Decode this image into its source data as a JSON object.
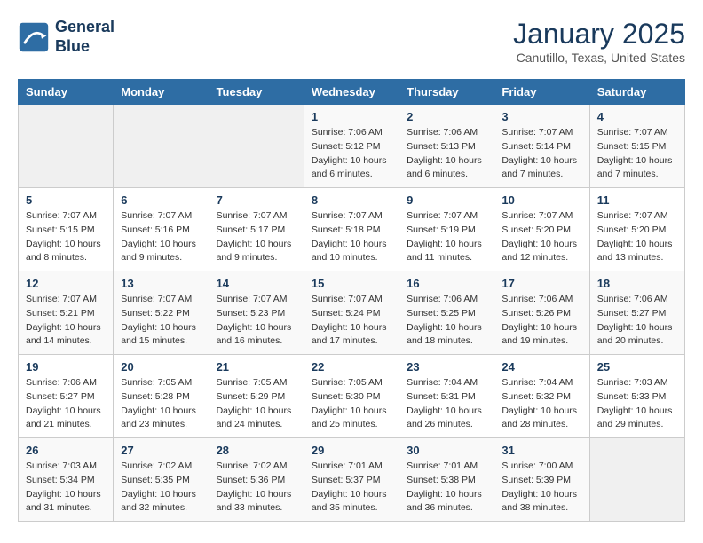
{
  "header": {
    "logo_line1": "General",
    "logo_line2": "Blue",
    "title": "January 2025",
    "subtitle": "Canutillo, Texas, United States"
  },
  "weekdays": [
    "Sunday",
    "Monday",
    "Tuesday",
    "Wednesday",
    "Thursday",
    "Friday",
    "Saturday"
  ],
  "weeks": [
    [
      {
        "day": "",
        "info": ""
      },
      {
        "day": "",
        "info": ""
      },
      {
        "day": "",
        "info": ""
      },
      {
        "day": "1",
        "info": "Sunrise: 7:06 AM\nSunset: 5:12 PM\nDaylight: 10 hours\nand 6 minutes."
      },
      {
        "day": "2",
        "info": "Sunrise: 7:06 AM\nSunset: 5:13 PM\nDaylight: 10 hours\nand 6 minutes."
      },
      {
        "day": "3",
        "info": "Sunrise: 7:07 AM\nSunset: 5:14 PM\nDaylight: 10 hours\nand 7 minutes."
      },
      {
        "day": "4",
        "info": "Sunrise: 7:07 AM\nSunset: 5:15 PM\nDaylight: 10 hours\nand 7 minutes."
      }
    ],
    [
      {
        "day": "5",
        "info": "Sunrise: 7:07 AM\nSunset: 5:15 PM\nDaylight: 10 hours\nand 8 minutes."
      },
      {
        "day": "6",
        "info": "Sunrise: 7:07 AM\nSunset: 5:16 PM\nDaylight: 10 hours\nand 9 minutes."
      },
      {
        "day": "7",
        "info": "Sunrise: 7:07 AM\nSunset: 5:17 PM\nDaylight: 10 hours\nand 9 minutes."
      },
      {
        "day": "8",
        "info": "Sunrise: 7:07 AM\nSunset: 5:18 PM\nDaylight: 10 hours\nand 10 minutes."
      },
      {
        "day": "9",
        "info": "Sunrise: 7:07 AM\nSunset: 5:19 PM\nDaylight: 10 hours\nand 11 minutes."
      },
      {
        "day": "10",
        "info": "Sunrise: 7:07 AM\nSunset: 5:20 PM\nDaylight: 10 hours\nand 12 minutes."
      },
      {
        "day": "11",
        "info": "Sunrise: 7:07 AM\nSunset: 5:20 PM\nDaylight: 10 hours\nand 13 minutes."
      }
    ],
    [
      {
        "day": "12",
        "info": "Sunrise: 7:07 AM\nSunset: 5:21 PM\nDaylight: 10 hours\nand 14 minutes."
      },
      {
        "day": "13",
        "info": "Sunrise: 7:07 AM\nSunset: 5:22 PM\nDaylight: 10 hours\nand 15 minutes."
      },
      {
        "day": "14",
        "info": "Sunrise: 7:07 AM\nSunset: 5:23 PM\nDaylight: 10 hours\nand 16 minutes."
      },
      {
        "day": "15",
        "info": "Sunrise: 7:07 AM\nSunset: 5:24 PM\nDaylight: 10 hours\nand 17 minutes."
      },
      {
        "day": "16",
        "info": "Sunrise: 7:06 AM\nSunset: 5:25 PM\nDaylight: 10 hours\nand 18 minutes."
      },
      {
        "day": "17",
        "info": "Sunrise: 7:06 AM\nSunset: 5:26 PM\nDaylight: 10 hours\nand 19 minutes."
      },
      {
        "day": "18",
        "info": "Sunrise: 7:06 AM\nSunset: 5:27 PM\nDaylight: 10 hours\nand 20 minutes."
      }
    ],
    [
      {
        "day": "19",
        "info": "Sunrise: 7:06 AM\nSunset: 5:27 PM\nDaylight: 10 hours\nand 21 minutes."
      },
      {
        "day": "20",
        "info": "Sunrise: 7:05 AM\nSunset: 5:28 PM\nDaylight: 10 hours\nand 23 minutes."
      },
      {
        "day": "21",
        "info": "Sunrise: 7:05 AM\nSunset: 5:29 PM\nDaylight: 10 hours\nand 24 minutes."
      },
      {
        "day": "22",
        "info": "Sunrise: 7:05 AM\nSunset: 5:30 PM\nDaylight: 10 hours\nand 25 minutes."
      },
      {
        "day": "23",
        "info": "Sunrise: 7:04 AM\nSunset: 5:31 PM\nDaylight: 10 hours\nand 26 minutes."
      },
      {
        "day": "24",
        "info": "Sunrise: 7:04 AM\nSunset: 5:32 PM\nDaylight: 10 hours\nand 28 minutes."
      },
      {
        "day": "25",
        "info": "Sunrise: 7:03 AM\nSunset: 5:33 PM\nDaylight: 10 hours\nand 29 minutes."
      }
    ],
    [
      {
        "day": "26",
        "info": "Sunrise: 7:03 AM\nSunset: 5:34 PM\nDaylight: 10 hours\nand 31 minutes."
      },
      {
        "day": "27",
        "info": "Sunrise: 7:02 AM\nSunset: 5:35 PM\nDaylight: 10 hours\nand 32 minutes."
      },
      {
        "day": "28",
        "info": "Sunrise: 7:02 AM\nSunset: 5:36 PM\nDaylight: 10 hours\nand 33 minutes."
      },
      {
        "day": "29",
        "info": "Sunrise: 7:01 AM\nSunset: 5:37 PM\nDaylight: 10 hours\nand 35 minutes."
      },
      {
        "day": "30",
        "info": "Sunrise: 7:01 AM\nSunset: 5:38 PM\nDaylight: 10 hours\nand 36 minutes."
      },
      {
        "day": "31",
        "info": "Sunrise: 7:00 AM\nSunset: 5:39 PM\nDaylight: 10 hours\nand 38 minutes."
      },
      {
        "day": "",
        "info": ""
      }
    ]
  ]
}
